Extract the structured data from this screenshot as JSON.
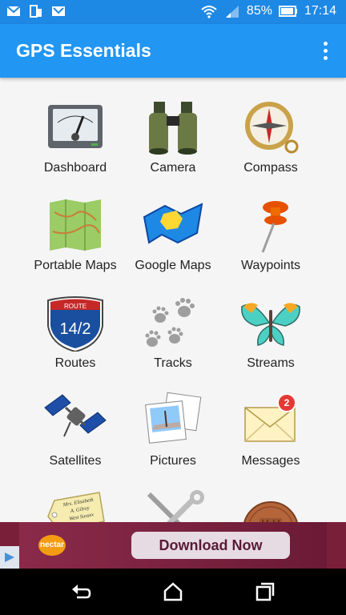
{
  "status": {
    "battery_percent": "85%",
    "time": "17:14"
  },
  "appbar": {
    "title": "GPS Essentials"
  },
  "tiles": [
    {
      "label": "Dashboard",
      "icon": "dashboard-icon"
    },
    {
      "label": "Camera",
      "icon": "binoculars-icon"
    },
    {
      "label": "Compass",
      "icon": "compass-icon"
    },
    {
      "label": "Portable Maps",
      "icon": "portable-map-icon"
    },
    {
      "label": "Google Maps",
      "icon": "google-map-icon"
    },
    {
      "label": "Waypoints",
      "icon": "pushpin-icon"
    },
    {
      "label": "Routes",
      "icon": "route-shield-icon"
    },
    {
      "label": "Tracks",
      "icon": "paw-tracks-icon"
    },
    {
      "label": "Streams",
      "icon": "butterfly-icon"
    },
    {
      "label": "Satellites",
      "icon": "satellite-icon"
    },
    {
      "label": "Pictures",
      "icon": "photos-icon"
    },
    {
      "label": "Messages",
      "icon": "envelope-icon",
      "badge": "2"
    },
    {
      "label": "",
      "icon": "tag-icon"
    },
    {
      "label": "",
      "icon": "tools-icon"
    },
    {
      "label": "",
      "icon": "coin-icon"
    }
  ],
  "route_sign": {
    "top": "ROUTE",
    "number": "14/2"
  },
  "tag_text": [
    "Mrs. Elisabeth",
    "A. Gilroy",
    "West Sussex"
  ],
  "ad": {
    "brand": "nectar",
    "button": "Download Now"
  }
}
